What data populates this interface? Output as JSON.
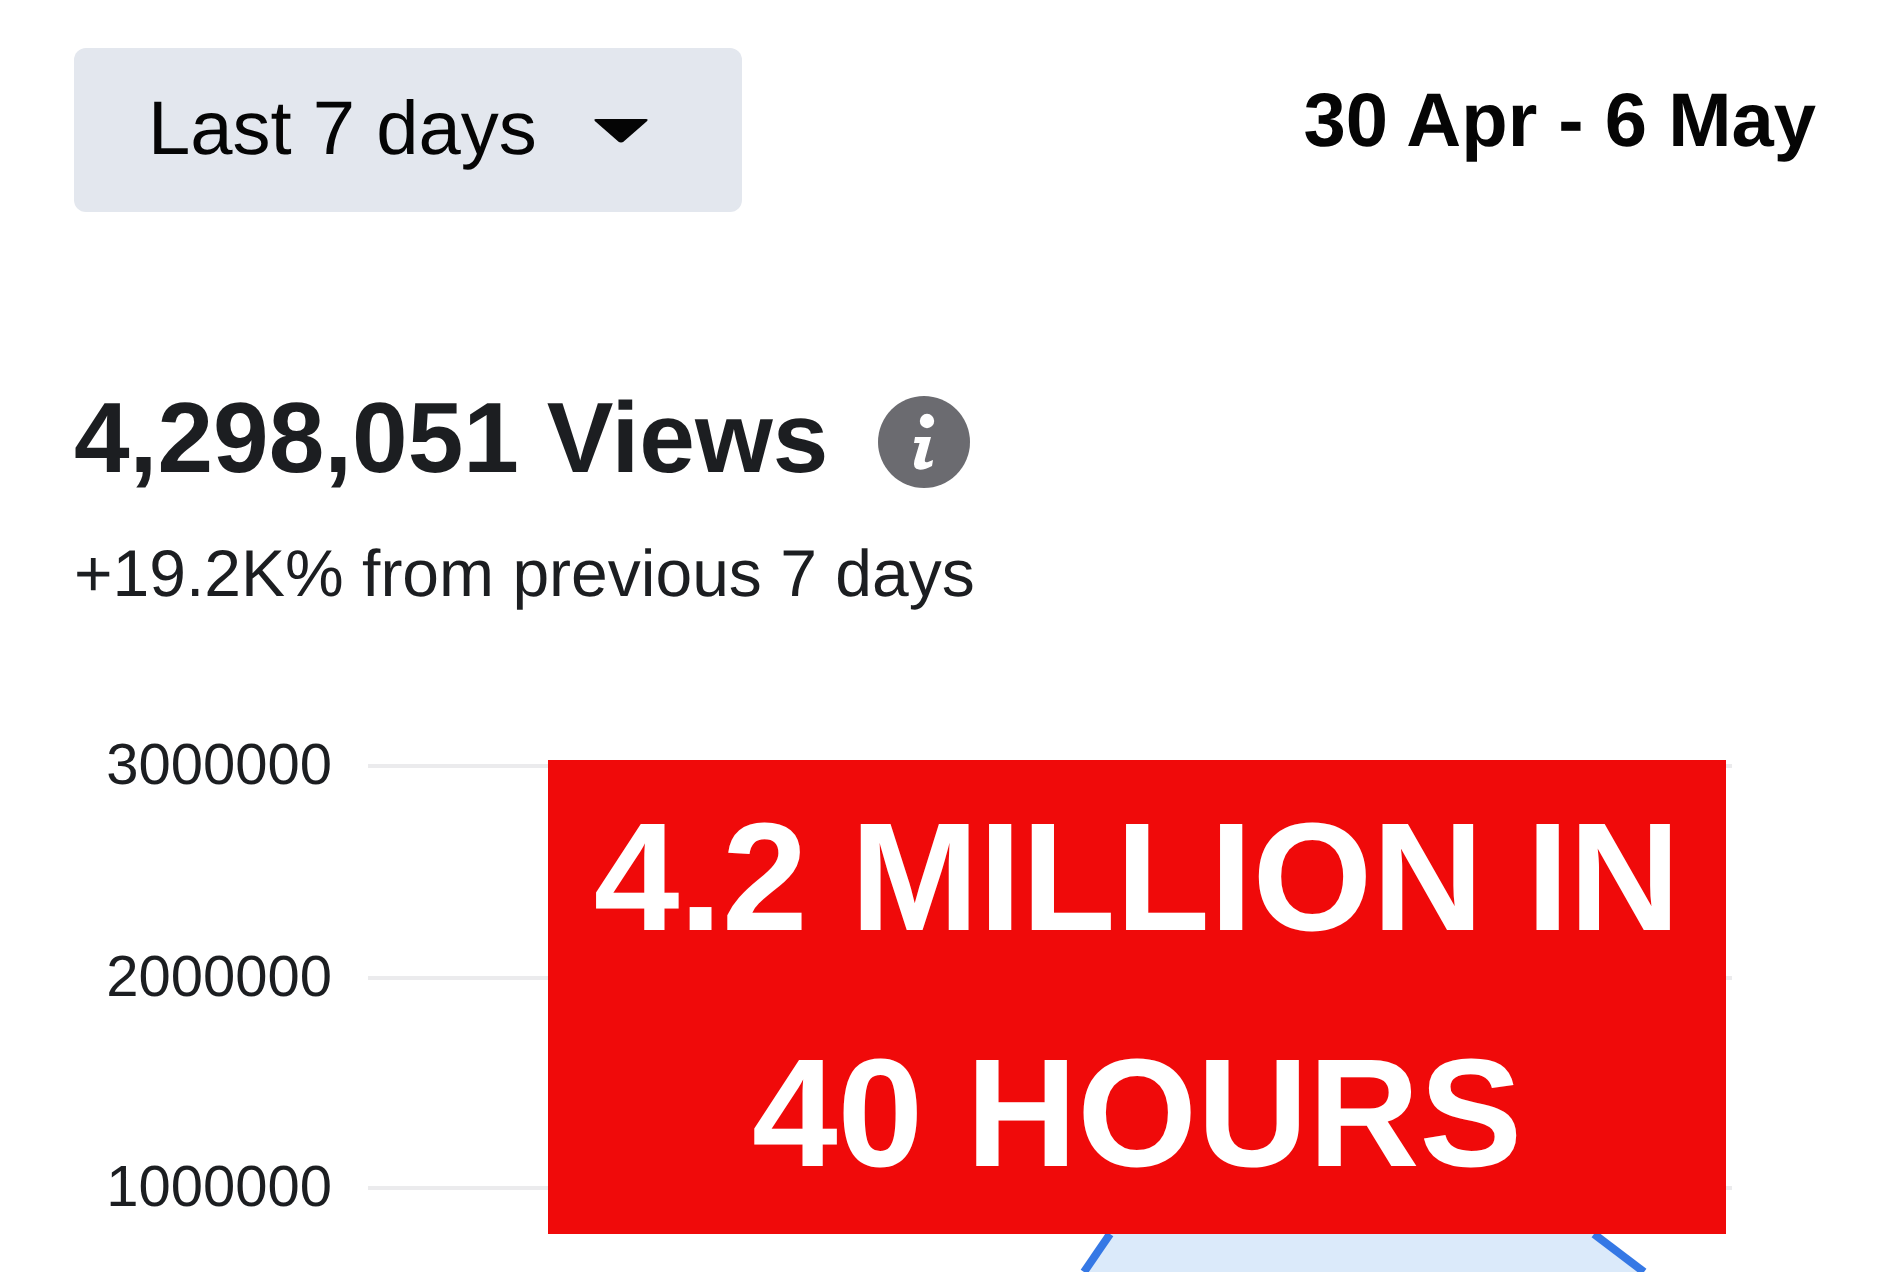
{
  "date_filter": {
    "label": "Last 7 days"
  },
  "date_range": "30 Apr - 6 May",
  "views": {
    "total": "4,298,051 Views",
    "change": "+19.2K% from previous 7 days"
  },
  "chart": {
    "y_axis_labels": [
      "3000000",
      "2000000",
      "1000000"
    ]
  },
  "overlay_banner": {
    "text": "4.2 MILLION IN 40 HOURS"
  }
}
